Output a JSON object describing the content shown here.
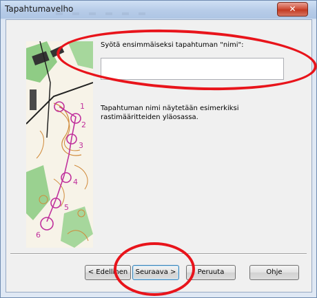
{
  "window": {
    "title": "Tapahtumavelho",
    "close_glyph": "✕"
  },
  "wizard": {
    "prompt": "Syötä ensimmäiseksi tapahtuman \"nimi\":",
    "name_value": "",
    "hint": "Tapahtuman nimi näytetään esimerkiksi rastimääritteiden yläosassa."
  },
  "map": {
    "control_numbers": [
      "1",
      "2",
      "3",
      "4",
      "5",
      "6"
    ],
    "course_color": "#c0309c",
    "contour_color": "#d08a3a",
    "green_color": "#7dc47a"
  },
  "buttons": {
    "back": "< Edellinen",
    "next": "Seuraava >",
    "cancel": "Peruuta",
    "help": "Ohje"
  },
  "annotation_color": "#e8141b"
}
